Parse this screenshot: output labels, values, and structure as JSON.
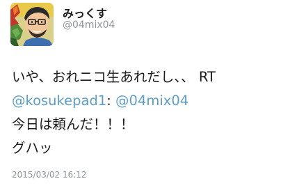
{
  "user": {
    "display_name": "みっくす",
    "handle": "@04mix04",
    "avatar_icon": "user-avatar-illustration-icon"
  },
  "tweet": {
    "line1": "いや、おれニコ生あれだし、、 RT",
    "mention1": "@kosukepad1",
    "separator": ": ",
    "mention2": "@04mix04",
    "line3": "今日は頼んだ！！！",
    "line4": "グハッ",
    "timestamp": "2015/03/02 16:12"
  },
  "colors": {
    "mention": "#5d9ec8",
    "text": "#1b1b1b",
    "muted": "#8e9499"
  }
}
